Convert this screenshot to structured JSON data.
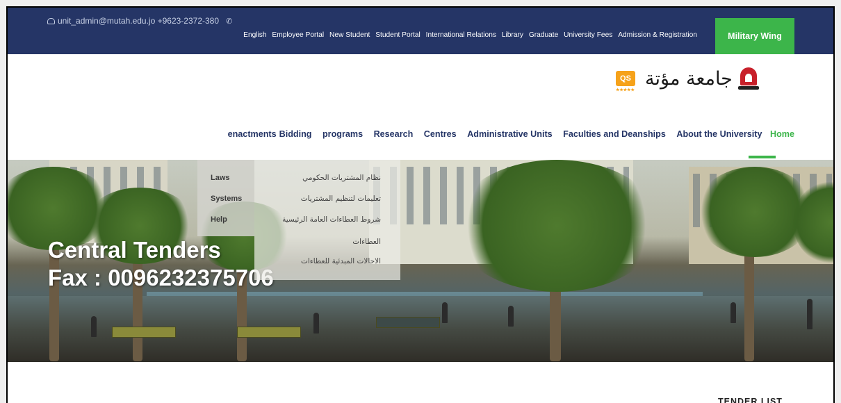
{
  "topbar": {
    "contact": "unit_admin@mutah.edu.jo +9623-2372-380",
    "links": [
      "English",
      "Employee Portal",
      "New Student",
      "Student Portal",
      "International Relations",
      "Library",
      "Graduate",
      "University Fees",
      "Admission & Registration"
    ],
    "military_button": "Military Wing",
    "bg_color": "#253566",
    "accent_color": "#3cb54a"
  },
  "logo": {
    "qs_badge": "QS",
    "qs_stars": "★★★★★",
    "university_name": "جامعة مؤتة"
  },
  "mainnav": {
    "items": [
      "enactments",
      "Bidding",
      "programs",
      "Research",
      "Centres",
      "Administrative Units",
      "Faculties and Deanships",
      "About the University",
      "Home"
    ],
    "active": "Home"
  },
  "hero": {
    "title_line1": "Central Tenders",
    "title_line2": "Fax : 0096232375706"
  },
  "dropdown": {
    "left_items": [
      "Laws",
      "Systems",
      "Help"
    ],
    "right_items": [
      "نظام المشتريات الحكومي",
      "تعليمات لتنظيم المشتريات",
      "شروط العطاءات العامة الرئيسية",
      "العطاءات",
      "الاحالات المبدئية للعطاءات"
    ]
  },
  "content": {
    "section_heading": "TENDER LIST"
  }
}
